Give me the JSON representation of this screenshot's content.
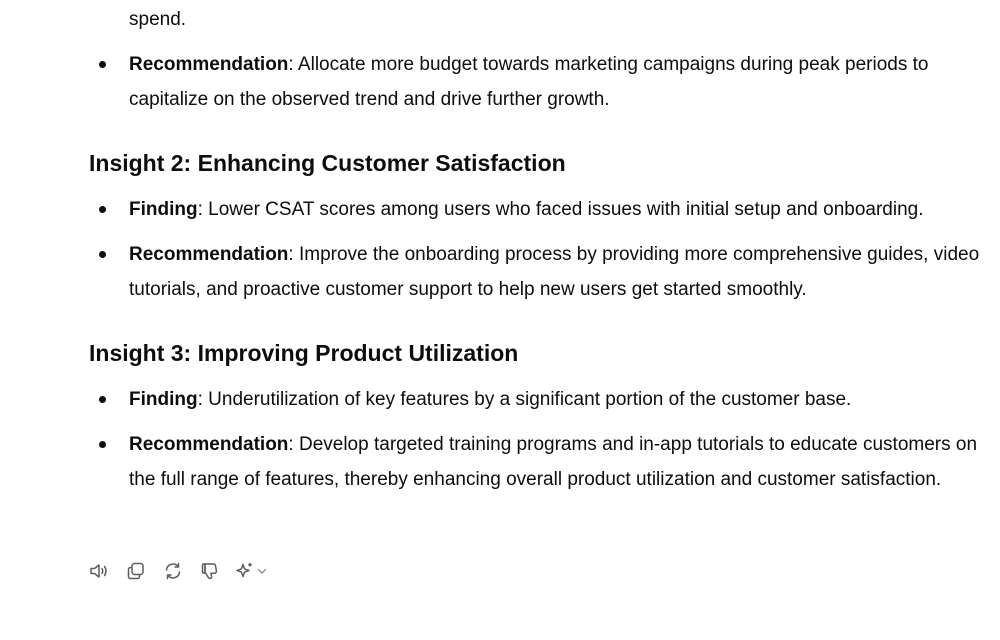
{
  "message": {
    "partial_line": "spend.",
    "blocks": [
      {
        "bullets": [
          {
            "label": "Recommendation",
            "text": ": Allocate more budget towards marketing campaigns during peak periods to capitalize on the observed trend and drive further growth."
          }
        ]
      },
      {
        "heading": "Insight 2: Enhancing Customer Satisfaction",
        "bullets": [
          {
            "label": "Finding",
            "text": ": Lower CSAT scores among users who faced issues with initial setup and onboarding."
          },
          {
            "label": "Recommendation",
            "text": ": Improve the onboarding process by providing more comprehensive guides, video tutorials, and proactive customer support to help new users get started smoothly."
          }
        ]
      },
      {
        "heading": "Insight 3: Improving Product Utilization",
        "bullets": [
          {
            "label": "Finding",
            "text": ": Underutilization of key features by a significant portion of the customer base."
          },
          {
            "label": "Recommendation",
            "text": ": Develop targeted training programs and in-app tutorials to educate customers on the full range of features, thereby enhancing overall product utilization and customer satisfaction."
          }
        ]
      }
    ]
  },
  "actions": [
    {
      "name": "read-aloud-icon"
    },
    {
      "name": "copy-icon"
    },
    {
      "name": "regenerate-icon"
    },
    {
      "name": "thumbs-down-icon"
    },
    {
      "name": "sparkle-icon"
    },
    {
      "name": "chevron-down-icon"
    }
  ],
  "colors": {
    "text": "#0d0d0d",
    "icon": "#5d5d5d",
    "background": "#ffffff"
  }
}
